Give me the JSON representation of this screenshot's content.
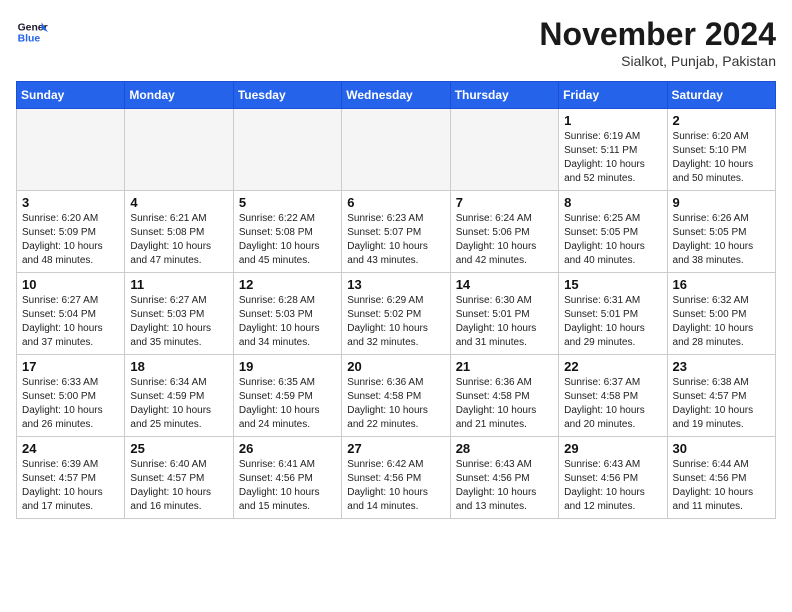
{
  "header": {
    "logo_line1": "General",
    "logo_line2": "Blue",
    "month": "November 2024",
    "location": "Sialkot, Punjab, Pakistan"
  },
  "weekdays": [
    "Sunday",
    "Monday",
    "Tuesday",
    "Wednesday",
    "Thursday",
    "Friday",
    "Saturday"
  ],
  "weeks": [
    [
      {
        "day": "",
        "content": ""
      },
      {
        "day": "",
        "content": ""
      },
      {
        "day": "",
        "content": ""
      },
      {
        "day": "",
        "content": ""
      },
      {
        "day": "",
        "content": ""
      },
      {
        "day": "1",
        "content": "Sunrise: 6:19 AM\nSunset: 5:11 PM\nDaylight: 10 hours\nand 52 minutes."
      },
      {
        "day": "2",
        "content": "Sunrise: 6:20 AM\nSunset: 5:10 PM\nDaylight: 10 hours\nand 50 minutes."
      }
    ],
    [
      {
        "day": "3",
        "content": "Sunrise: 6:20 AM\nSunset: 5:09 PM\nDaylight: 10 hours\nand 48 minutes."
      },
      {
        "day": "4",
        "content": "Sunrise: 6:21 AM\nSunset: 5:08 PM\nDaylight: 10 hours\nand 47 minutes."
      },
      {
        "day": "5",
        "content": "Sunrise: 6:22 AM\nSunset: 5:08 PM\nDaylight: 10 hours\nand 45 minutes."
      },
      {
        "day": "6",
        "content": "Sunrise: 6:23 AM\nSunset: 5:07 PM\nDaylight: 10 hours\nand 43 minutes."
      },
      {
        "day": "7",
        "content": "Sunrise: 6:24 AM\nSunset: 5:06 PM\nDaylight: 10 hours\nand 42 minutes."
      },
      {
        "day": "8",
        "content": "Sunrise: 6:25 AM\nSunset: 5:05 PM\nDaylight: 10 hours\nand 40 minutes."
      },
      {
        "day": "9",
        "content": "Sunrise: 6:26 AM\nSunset: 5:05 PM\nDaylight: 10 hours\nand 38 minutes."
      }
    ],
    [
      {
        "day": "10",
        "content": "Sunrise: 6:27 AM\nSunset: 5:04 PM\nDaylight: 10 hours\nand 37 minutes."
      },
      {
        "day": "11",
        "content": "Sunrise: 6:27 AM\nSunset: 5:03 PM\nDaylight: 10 hours\nand 35 minutes."
      },
      {
        "day": "12",
        "content": "Sunrise: 6:28 AM\nSunset: 5:03 PM\nDaylight: 10 hours\nand 34 minutes."
      },
      {
        "day": "13",
        "content": "Sunrise: 6:29 AM\nSunset: 5:02 PM\nDaylight: 10 hours\nand 32 minutes."
      },
      {
        "day": "14",
        "content": "Sunrise: 6:30 AM\nSunset: 5:01 PM\nDaylight: 10 hours\nand 31 minutes."
      },
      {
        "day": "15",
        "content": "Sunrise: 6:31 AM\nSunset: 5:01 PM\nDaylight: 10 hours\nand 29 minutes."
      },
      {
        "day": "16",
        "content": "Sunrise: 6:32 AM\nSunset: 5:00 PM\nDaylight: 10 hours\nand 28 minutes."
      }
    ],
    [
      {
        "day": "17",
        "content": "Sunrise: 6:33 AM\nSunset: 5:00 PM\nDaylight: 10 hours\nand 26 minutes."
      },
      {
        "day": "18",
        "content": "Sunrise: 6:34 AM\nSunset: 4:59 PM\nDaylight: 10 hours\nand 25 minutes."
      },
      {
        "day": "19",
        "content": "Sunrise: 6:35 AM\nSunset: 4:59 PM\nDaylight: 10 hours\nand 24 minutes."
      },
      {
        "day": "20",
        "content": "Sunrise: 6:36 AM\nSunset: 4:58 PM\nDaylight: 10 hours\nand 22 minutes."
      },
      {
        "day": "21",
        "content": "Sunrise: 6:36 AM\nSunset: 4:58 PM\nDaylight: 10 hours\nand 21 minutes."
      },
      {
        "day": "22",
        "content": "Sunrise: 6:37 AM\nSunset: 4:58 PM\nDaylight: 10 hours\nand 20 minutes."
      },
      {
        "day": "23",
        "content": "Sunrise: 6:38 AM\nSunset: 4:57 PM\nDaylight: 10 hours\nand 19 minutes."
      }
    ],
    [
      {
        "day": "24",
        "content": "Sunrise: 6:39 AM\nSunset: 4:57 PM\nDaylight: 10 hours\nand 17 minutes."
      },
      {
        "day": "25",
        "content": "Sunrise: 6:40 AM\nSunset: 4:57 PM\nDaylight: 10 hours\nand 16 minutes."
      },
      {
        "day": "26",
        "content": "Sunrise: 6:41 AM\nSunset: 4:56 PM\nDaylight: 10 hours\nand 15 minutes."
      },
      {
        "day": "27",
        "content": "Sunrise: 6:42 AM\nSunset: 4:56 PM\nDaylight: 10 hours\nand 14 minutes."
      },
      {
        "day": "28",
        "content": "Sunrise: 6:43 AM\nSunset: 4:56 PM\nDaylight: 10 hours\nand 13 minutes."
      },
      {
        "day": "29",
        "content": "Sunrise: 6:43 AM\nSunset: 4:56 PM\nDaylight: 10 hours\nand 12 minutes."
      },
      {
        "day": "30",
        "content": "Sunrise: 6:44 AM\nSunset: 4:56 PM\nDaylight: 10 hours\nand 11 minutes."
      }
    ]
  ]
}
